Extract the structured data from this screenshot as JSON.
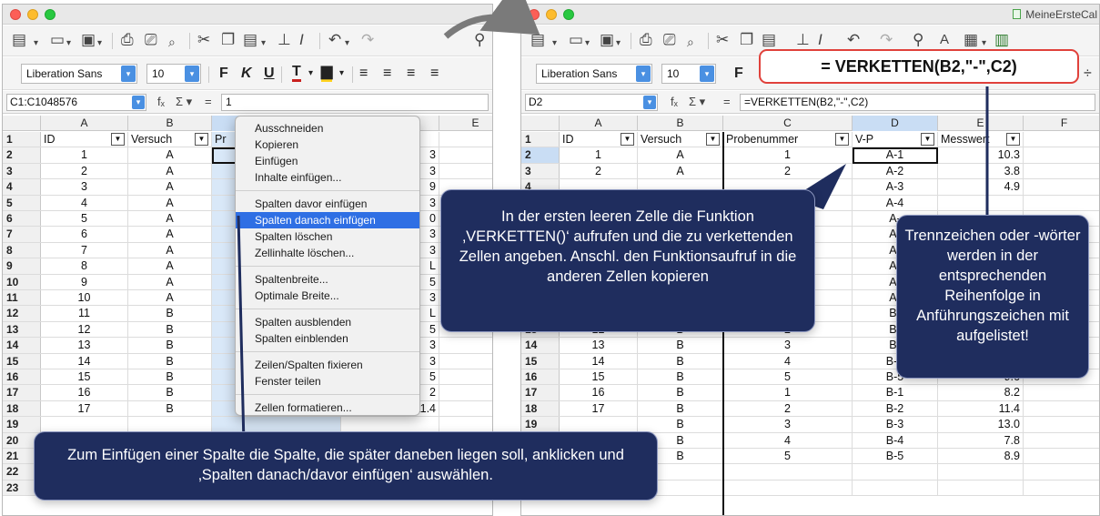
{
  "left_window": {
    "toolbar": {
      "font_name": "Liberation Sans",
      "font_size": "10"
    },
    "formula_bar": {
      "name_box": "C1:C1048576",
      "formula": "1"
    },
    "columns": [
      "A",
      "B",
      "C",
      "D",
      "E"
    ],
    "header_values": [
      "ID",
      "Versuch",
      "Pr"
    ],
    "rows": [
      {
        "n": "1"
      },
      {
        "n": "2",
        "a": "1",
        "b": "A",
        "d": "3"
      },
      {
        "n": "3",
        "a": "2",
        "b": "A",
        "d": "3"
      },
      {
        "n": "4",
        "a": "3",
        "b": "A",
        "d": "9"
      },
      {
        "n": "5",
        "a": "4",
        "b": "A",
        "d": "3"
      },
      {
        "n": "6",
        "a": "5",
        "b": "A",
        "d": "0"
      },
      {
        "n": "7",
        "a": "6",
        "b": "A",
        "d": "3"
      },
      {
        "n": "8",
        "a": "7",
        "b": "A",
        "d": "3"
      },
      {
        "n": "9",
        "a": "8",
        "b": "A",
        "d": "L"
      },
      {
        "n": "10",
        "a": "9",
        "b": "A",
        "d": "5"
      },
      {
        "n": "11",
        "a": "10",
        "b": "A",
        "d": "3"
      },
      {
        "n": "12",
        "a": "11",
        "b": "B",
        "d": "L"
      },
      {
        "n": "13",
        "a": "12",
        "b": "B",
        "d": "5"
      },
      {
        "n": "14",
        "a": "13",
        "b": "B",
        "d": "3"
      },
      {
        "n": "15",
        "a": "14",
        "b": "B",
        "d": "3"
      },
      {
        "n": "16",
        "a": "15",
        "b": "B",
        "d": "5"
      },
      {
        "n": "17",
        "a": "16",
        "b": "B",
        "d": "2"
      },
      {
        "n": "18",
        "a": "17",
        "b": "B",
        "c": "2",
        "d": "11.4"
      },
      {
        "n": "19"
      },
      {
        "n": "20"
      },
      {
        "n": "21"
      },
      {
        "n": "22"
      },
      {
        "n": "23"
      }
    ],
    "context_menu": {
      "groups": [
        [
          "Ausschneiden",
          "Kopieren",
          "Einfügen",
          "Inhalte einfügen..."
        ],
        [
          "Spalten davor einfügen",
          "Spalten danach einfügen",
          "Spalten löschen",
          "Zellinhalte löschen..."
        ],
        [
          "Spaltenbreite...",
          "Optimale Breite..."
        ],
        [
          "Spalten ausblenden",
          "Spalten einblenden"
        ],
        [
          "Zeilen/Spalten fixieren",
          "Fenster teilen"
        ],
        [
          "Zellen formatieren..."
        ]
      ],
      "highlighted": "Spalten danach einfügen"
    }
  },
  "right_window": {
    "title": "MeineErsteCal",
    "toolbar": {
      "font_name": "Liberation Sans",
      "font_size": "10"
    },
    "formula_bar": {
      "name_box": "D2",
      "formula": "=VERKETTEN(B2,\"-\",C2)"
    },
    "columns": [
      "A",
      "B",
      "C",
      "D",
      "E",
      "F"
    ],
    "header_values": [
      "ID",
      "Versuch",
      "Probenummer",
      "V-P",
      "Messwert"
    ],
    "rows": [
      {
        "n": "1"
      },
      {
        "n": "2",
        "a": "1",
        "b": "A",
        "c": "1",
        "d": "A-1",
        "e": "10.3"
      },
      {
        "n": "3",
        "a": "2",
        "b": "A",
        "c": "2",
        "d": "A-2",
        "e": "3.8"
      },
      {
        "n": "4",
        "d": "A-3",
        "e": "4.9"
      },
      {
        "n": "5",
        "d": "A-4"
      },
      {
        "n": "6",
        "d": "A-"
      },
      {
        "n": "7",
        "d": "A-"
      },
      {
        "n": "8",
        "d": "A-"
      },
      {
        "n": "9",
        "d": "A-"
      },
      {
        "n": "10",
        "d": "A-"
      },
      {
        "n": "11",
        "d": "A-"
      },
      {
        "n": "12",
        "d": "B-"
      },
      {
        "n": "13",
        "a": "12",
        "b": "B",
        "c": "2",
        "d": "B-"
      },
      {
        "n": "14",
        "a": "13",
        "b": "B",
        "c": "3",
        "d": "B-"
      },
      {
        "n": "15",
        "a": "14",
        "b": "B",
        "c": "4",
        "d": "B-4"
      },
      {
        "n": "16",
        "a": "15",
        "b": "B",
        "c": "5",
        "d": "B-5",
        "e": "9.6"
      },
      {
        "n": "17",
        "a": "16",
        "b": "B",
        "c": "1",
        "d": "B-1",
        "e": "8.2"
      },
      {
        "n": "18",
        "a": "17",
        "b": "B",
        "c": "2",
        "d": "B-2",
        "e": "11.4"
      },
      {
        "n": "19",
        "b": "B",
        "c": "3",
        "d": "B-3",
        "e": "13.0"
      },
      {
        "n": "20",
        "b": "B",
        "c": "4",
        "d": "B-4",
        "e": "7.8"
      },
      {
        "n": "21",
        "b": "B",
        "c": "5",
        "d": "B-5",
        "e": "8.9"
      },
      {
        "n": "22"
      },
      {
        "n": "23"
      }
    ]
  },
  "callouts": {
    "formula": "= VERKETTEN(B2,\"-\",C2)",
    "instruction_verketten": "In der ersten leeren Zelle die Funktion ‚VERKETTEN()‘ aufrufen und die zu verkettenden Zellen angeben. Anschl. den Funktionsaufruf in die anderen Zellen kopieren",
    "separator_note": "Trennzeichen oder -wörter werden in der entsprechenden Reihenfolge in Anführungszeichen mit aufgelistet!",
    "insert_column_note": "Zum Einfügen einer Spalte die Spalte, die später daneben liegen soll, anklicken und ‚Spalten danach/davor einfügen‘ auswählen."
  },
  "colors": {
    "callout_bg": "#1f2d5e",
    "formula_callout_border": "#e0413b",
    "selection": "#c9ddf4",
    "menu_highlight": "#2f6fe4"
  }
}
